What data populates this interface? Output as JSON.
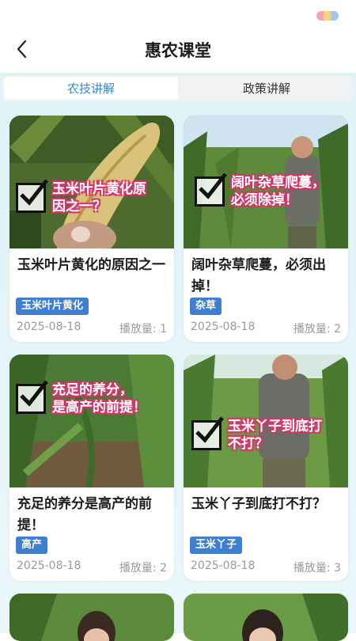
{
  "header": {
    "title": "惠农课堂"
  },
  "tabs": [
    {
      "label": "农技讲解",
      "active": true
    },
    {
      "label": "政策讲解",
      "active": false
    }
  ],
  "colors": {
    "accent": "#2f8ad8",
    "tag_bg": "#3e7fd1",
    "overlay_stroke": "#d9336a"
  },
  "cards": [
    {
      "title": "玉米叶片黄化的原因之一",
      "overlay_line1": "玉米叶片黄化原",
      "overlay_line2": "因之一？",
      "tag": "玉米叶片黄化",
      "date": "2025-08-18",
      "plays": "播放量: 1"
    },
    {
      "title": "阔叶杂草爬蔓，必须出掉！",
      "overlay_line1": "阔叶杂草爬蔓，",
      "overlay_line2": "必须除掉！",
      "tag": "杂草",
      "date": "2025-08-18",
      "plays": "播放量: 2"
    },
    {
      "title": "充足的养分是高产的前提！",
      "overlay_line1": "充足的养分，",
      "overlay_line2": "是高产的前提！",
      "tag": "高产",
      "date": "2025-08-18",
      "plays": "播放量: 2"
    },
    {
      "title": "玉米丫子到底打不打？",
      "overlay_line1": "玉米丫子到底打",
      "overlay_line2": "不打？",
      "tag": "玉米丫子",
      "date": "2025-08-18",
      "plays": "播放量: 3"
    }
  ]
}
